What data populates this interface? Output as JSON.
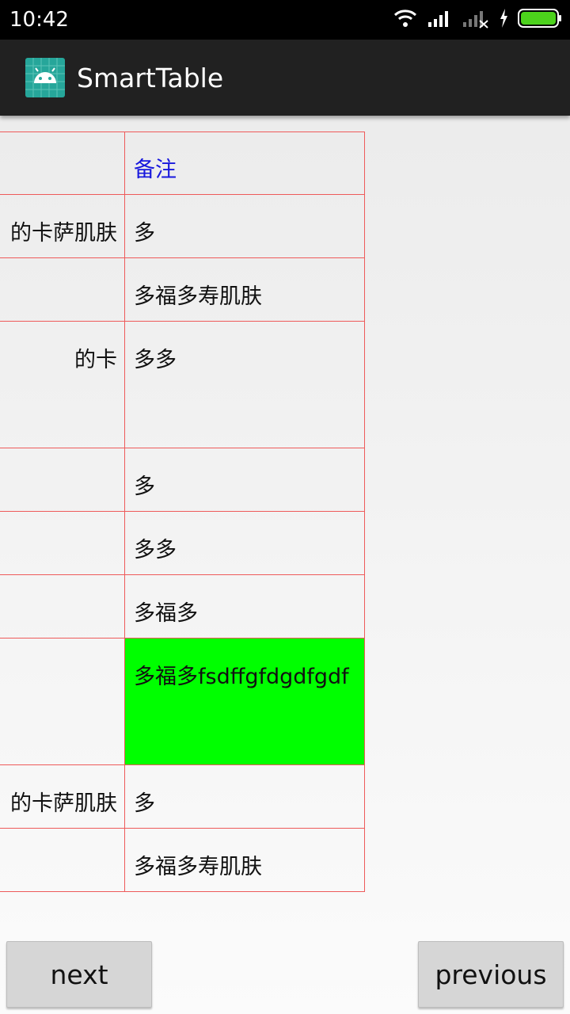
{
  "status_bar": {
    "time": "10:42",
    "icons": [
      "wifi-icon",
      "signal-icon",
      "signal-off-icon",
      "charging-icon",
      "battery-icon"
    ],
    "battery_color": "#4cd21c"
  },
  "app_bar": {
    "title": "SmartTable",
    "icon": "android-icon",
    "icon_color": "#26a69a"
  },
  "table": {
    "header": {
      "col1": "",
      "col2": "备注"
    },
    "rows": [
      {
        "col1": "的卡萨肌肤",
        "col2": "多",
        "highlight": false
      },
      {
        "col1": "",
        "col2": "多福多寿肌肤",
        "highlight": false
      },
      {
        "col1": "的卡",
        "col2": "多多",
        "highlight": false
      },
      {
        "col1": "",
        "col2": "多",
        "highlight": false
      },
      {
        "col1": "",
        "col2": "多多",
        "highlight": false
      },
      {
        "col1": "",
        "col2": "多福多",
        "highlight": false
      },
      {
        "col1": "",
        "col2": "多福多fsdffgfdgdfgdf",
        "highlight": true
      },
      {
        "col1": "的卡萨肌肤",
        "col2": "多",
        "highlight": false
      },
      {
        "col1": "",
        "col2": "多福多寿肌肤",
        "highlight": false
      }
    ],
    "border_color": "#ee5a5a",
    "header_text_color": "#1818dd",
    "highlight_color": "#00ff00"
  },
  "buttons": {
    "next": "next",
    "previous": "previous"
  }
}
